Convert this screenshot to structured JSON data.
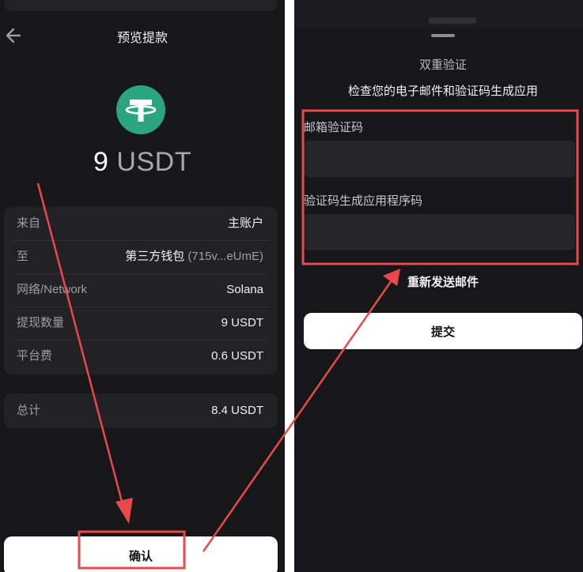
{
  "left": {
    "header": {
      "title": "预览提款"
    },
    "asset": {
      "amount": "9",
      "currency": "USDT",
      "icon": "tether-icon",
      "color": "#2aa57f"
    },
    "details": [
      {
        "label": "来自",
        "value": "主账户",
        "sub": ""
      },
      {
        "label": "至",
        "value": "第三方钱包",
        "sub": "(715v...eUmE)"
      },
      {
        "label": "网络/Network",
        "value": "Solana",
        "sub": ""
      },
      {
        "label": "提现数量",
        "value": "9 USDT",
        "sub": ""
      },
      {
        "label": "平台费",
        "value": "0.6 USDT",
        "sub": ""
      }
    ],
    "total": {
      "label": "总计",
      "value": "8.4 USDT"
    },
    "confirm_label": "确认"
  },
  "right": {
    "title": "双重验证",
    "subtitle": "检查您的电子邮件和验证码生成应用",
    "email_code_label": "邮箱验证码",
    "auth_code_label": "验证码生成应用程序码",
    "resend_label": "重新发送邮件",
    "submit_label": "提交"
  },
  "annotation_color": "#e9494c"
}
